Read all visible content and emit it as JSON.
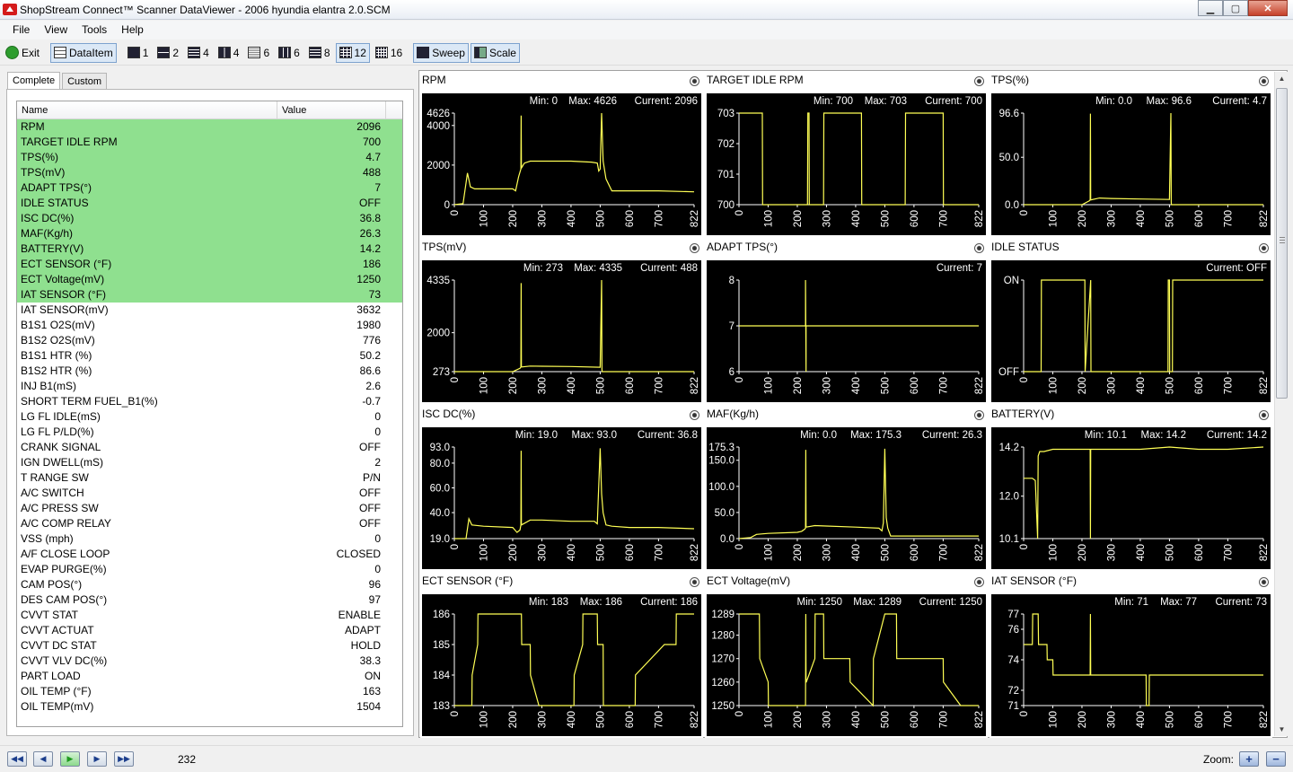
{
  "window": {
    "title": "ShopStream Connect™ Scanner DataViewer - 2006 hyundia elantra 2.0.SCM"
  },
  "menu": [
    "File",
    "View",
    "Tools",
    "Help"
  ],
  "toolbar": {
    "exit": "Exit",
    "dataitem": "DataItem",
    "layouts": [
      "1",
      "2",
      "4",
      "4",
      "6",
      "6",
      "8",
      "12",
      "16"
    ],
    "sweep": "Sweep",
    "scale": "Scale"
  },
  "tabs": [
    "Complete",
    "Custom"
  ],
  "grid": {
    "headers": [
      "Name",
      "Value"
    ],
    "rows": [
      [
        "RPM",
        "2096"
      ],
      [
        "TARGET IDLE RPM",
        "700"
      ],
      [
        "TPS(%)",
        "4.7"
      ],
      [
        "TPS(mV)",
        "488"
      ],
      [
        "ADAPT TPS(°)",
        "7"
      ],
      [
        "IDLE STATUS",
        "OFF"
      ],
      [
        "ISC DC(%)",
        "36.8"
      ],
      [
        "MAF(Kg/h)",
        "26.3"
      ],
      [
        "BATTERY(V)",
        "14.2"
      ],
      [
        "ECT SENSOR (°F)",
        "186"
      ],
      [
        "ECT Voltage(mV)",
        "1250"
      ],
      [
        "IAT SENSOR (°F)",
        "73"
      ],
      [
        "IAT SENSOR(mV)",
        "3632"
      ],
      [
        "B1S1 O2S(mV)",
        "1980"
      ],
      [
        "B1S2 O2S(mV)",
        "776"
      ],
      [
        "B1S1 HTR (%)",
        "50.2"
      ],
      [
        "B1S2 HTR (%)",
        "86.6"
      ],
      [
        "INJ B1(mS)",
        "2.6"
      ],
      [
        "SHORT TERM FUEL_B1(%)",
        "-0.7"
      ],
      [
        "LG FL IDLE(mS)",
        "0"
      ],
      [
        "LG FL P/LD(%)",
        "0"
      ],
      [
        "CRANK SIGNAL",
        "OFF"
      ],
      [
        "IGN DWELL(mS)",
        "2"
      ],
      [
        "T RANGE SW",
        "P/N"
      ],
      [
        "A/C SWITCH",
        "OFF"
      ],
      [
        "A/C PRESS SW",
        "OFF"
      ],
      [
        "A/C COMP RELAY",
        "OFF"
      ],
      [
        "VSS (mph)",
        "0"
      ],
      [
        "A/F CLOSE LOOP",
        "CLOSED"
      ],
      [
        "EVAP PURGE(%)",
        "0"
      ],
      [
        "CAM POS(°)",
        "96"
      ],
      [
        "DES CAM POS(°)",
        "97"
      ],
      [
        "CVVT STAT",
        "ENABLE"
      ],
      [
        "CVVT ACTUAT",
        "ADAPT"
      ],
      [
        "CVVT DC STAT",
        "HOLD"
      ],
      [
        "CVVT VLV DC(%)",
        "38.3"
      ],
      [
        "PART LOAD",
        "ON"
      ],
      [
        "OIL TEMP (°F)",
        "163"
      ],
      [
        "OIL TEMP(mV)",
        "1504"
      ]
    ],
    "highlight_count": 12,
    "highlight_color": "#8fe08f"
  },
  "xticks": [
    "0",
    "100",
    "200",
    "300",
    "400",
    "500",
    "600",
    "700",
    "822"
  ],
  "chart_data": [
    {
      "type": "line",
      "title": "RPM",
      "stats": {
        "min": "Min: 0",
        "max": "Max: 4626",
        "cur": "Current: 2096"
      },
      "yticks": [
        "4626",
        "4000",
        "2000",
        "0"
      ],
      "ylim": [
        0,
        4626
      ],
      "x": [
        0,
        30,
        45,
        55,
        70,
        80,
        200,
        210,
        220,
        228,
        229,
        230,
        240,
        260,
        300,
        400,
        470,
        490,
        495,
        500,
        505,
        510,
        520,
        540,
        600,
        700,
        822
      ],
      "y": [
        0,
        50,
        1600,
        900,
        800,
        800,
        800,
        700,
        1400,
        1800,
        4500,
        1850,
        2100,
        2200,
        2200,
        2200,
        2150,
        2100,
        1700,
        1800,
        4626,
        2200,
        1300,
        700,
        700,
        700,
        650
      ]
    },
    {
      "type": "line",
      "title": "TARGET IDLE RPM",
      "stats": {
        "min": "Min: 700",
        "max": "Max: 703",
        "cur": "Current: 700"
      },
      "yticks": [
        "703",
        "702",
        "701",
        "700"
      ],
      "ylim": [
        700,
        703
      ],
      "x": [
        0,
        80,
        81,
        235,
        236,
        240,
        241,
        290,
        291,
        420,
        421,
        570,
        571,
        700,
        701,
        822
      ],
      "y": [
        703,
        703,
        700,
        700,
        703,
        703,
        700,
        700,
        703,
        703,
        700,
        700,
        703,
        703,
        700,
        700
      ]
    },
    {
      "type": "line",
      "title": "TPS(%)",
      "stats": {
        "min": "Min: 0.0",
        "max": "Max: 96.6",
        "cur": "Current: 4.7"
      },
      "yticks": [
        "96.6",
        "50.0",
        "0.0"
      ],
      "ylim": [
        0,
        96.6
      ],
      "x": [
        0,
        200,
        225,
        228,
        229,
        230,
        260,
        300,
        400,
        500,
        505,
        506,
        507,
        560,
        822
      ],
      "y": [
        0,
        0,
        4,
        5,
        96,
        5,
        7,
        6.5,
        6,
        5.5,
        96.6,
        2,
        0,
        0,
        0
      ]
    },
    {
      "type": "line",
      "title": "TPS(mV)",
      "stats": {
        "min": "Min: 273",
        "max": "Max: 4335",
        "cur": "Current: 488"
      },
      "yticks": [
        "4335",
        "2000",
        "273"
      ],
      "ylim": [
        273,
        4335
      ],
      "x": [
        0,
        200,
        225,
        228,
        229,
        230,
        260,
        300,
        400,
        500,
        505,
        506,
        507,
        560,
        822
      ],
      "y": [
        273,
        273,
        420,
        480,
        4200,
        480,
        520,
        510,
        500,
        470,
        4335,
        350,
        273,
        273,
        273
      ]
    },
    {
      "type": "line",
      "title": "ADAPT TPS(°)",
      "stats": {
        "min": "",
        "max": "",
        "cur": "Current: 7"
      },
      "yticks": [
        "8",
        "7",
        "6"
      ],
      "ylim": [
        6,
        8
      ],
      "x": [
        0,
        228,
        228,
        230,
        230,
        822
      ],
      "y": [
        7,
        7,
        8,
        6,
        7,
        7
      ]
    },
    {
      "type": "line",
      "title": "IDLE STATUS",
      "stats": {
        "min": "",
        "max": "",
        "cur": "Current: OFF"
      },
      "yticks": [
        "ON",
        "OFF"
      ],
      "ylim": [
        0,
        1
      ],
      "x": [
        0,
        60,
        61,
        210,
        211,
        230,
        231,
        495,
        496,
        500,
        501,
        510,
        511,
        520,
        521,
        822
      ],
      "y": [
        0,
        0,
        1,
        1,
        0,
        1,
        0,
        0,
        1,
        1,
        0,
        0,
        1,
        1,
        1,
        1
      ]
    },
    {
      "type": "line",
      "title": "ISC DC(%)",
      "stats": {
        "min": "Min: 19.0",
        "max": "Max: 93.0",
        "cur": "Current: 36.8"
      },
      "yticks": [
        "93.0",
        "80.0",
        "60.0",
        "40.0",
        "19.0"
      ],
      "ylim": [
        19,
        93
      ],
      "x": [
        0,
        40,
        50,
        60,
        100,
        200,
        215,
        225,
        228,
        229,
        230,
        260,
        300,
        400,
        480,
        490,
        500,
        505,
        510,
        520,
        540,
        600,
        700,
        822
      ],
      "y": [
        19,
        19,
        35,
        30,
        29,
        28,
        24,
        26,
        30,
        90,
        30,
        34,
        34,
        33,
        33,
        31,
        92,
        55,
        40,
        30,
        29,
        28,
        28,
        27
      ]
    },
    {
      "type": "line",
      "title": "MAF(Kg/h)",
      "stats": {
        "min": "Min: 0.0",
        "max": "Max: 175.3",
        "cur": "Current: 26.3"
      },
      "yticks": [
        "175.3",
        "150.0",
        "100.0",
        "50.0",
        "0.0"
      ],
      "ylim": [
        0,
        175.3
      ],
      "x": [
        0,
        40,
        60,
        100,
        200,
        215,
        225,
        228,
        229,
        230,
        260,
        300,
        400,
        480,
        490,
        495,
        500,
        505,
        510,
        520,
        600,
        700,
        822
      ],
      "y": [
        0,
        2,
        8,
        10,
        12,
        14,
        18,
        20,
        170,
        22,
        25,
        24,
        22,
        20,
        15,
        30,
        172,
        40,
        20,
        5,
        5,
        5,
        5
      ]
    },
    {
      "type": "line",
      "title": "BATTERY(V)",
      "stats": {
        "min": "Min: 10.1",
        "max": "Max: 14.2",
        "cur": "Current: 14.2"
      },
      "yticks": [
        "14.2",
        "12.0",
        "10.1"
      ],
      "ylim": [
        10.1,
        14.2
      ],
      "x": [
        0,
        30,
        40,
        48,
        50,
        55,
        70,
        100,
        200,
        228,
        229,
        230,
        231,
        300,
        400,
        500,
        600,
        700,
        822
      ],
      "y": [
        12.8,
        12.8,
        12.7,
        10.1,
        13.8,
        14.0,
        14.0,
        14.1,
        14.1,
        14.1,
        10.1,
        14.1,
        14.1,
        14.1,
        14.1,
        14.2,
        14.1,
        14.1,
        14.2
      ]
    },
    {
      "type": "line",
      "title": "ECT SENSOR (°F)",
      "stats": {
        "min": "Min: 183",
        "max": "Max: 186",
        "cur": "Current: 186"
      },
      "yticks": [
        "186",
        "185",
        "184",
        "183"
      ],
      "ylim": [
        183,
        186
      ],
      "x": [
        0,
        60,
        61,
        80,
        81,
        230,
        231,
        260,
        261,
        290,
        291,
        410,
        411,
        440,
        441,
        490,
        491,
        510,
        511,
        520,
        521,
        620,
        621,
        720,
        721,
        760,
        761,
        822
      ],
      "y": [
        183,
        183,
        184,
        185,
        186,
        186,
        185,
        185,
        184,
        183,
        183,
        183,
        184,
        185,
        186,
        186,
        185,
        185,
        183,
        183,
        183,
        183,
        184,
        185,
        185,
        185,
        186,
        186
      ]
    },
    {
      "type": "line",
      "title": "ECT Voltage(mV)",
      "stats": {
        "min": "Min: 1250",
        "max": "Max: 1289",
        "cur": "Current: 1250"
      },
      "yticks": [
        "1289",
        "1280",
        "1270",
        "1260",
        "1250"
      ],
      "ylim": [
        1250,
        1289
      ],
      "x": [
        0,
        70,
        71,
        100,
        101,
        228,
        229,
        230,
        231,
        260,
        261,
        290,
        291,
        380,
        381,
        460,
        461,
        500,
        501,
        540,
        541,
        600,
        601,
        700,
        701,
        760,
        761,
        822
      ],
      "y": [
        1289,
        1289,
        1270,
        1260,
        1250,
        1250,
        1289,
        1260,
        1260,
        1270,
        1289,
        1289,
        1270,
        1270,
        1260,
        1250,
        1270,
        1289,
        1289,
        1289,
        1270,
        1270,
        1270,
        1270,
        1260,
        1250,
        1250,
        1250
      ]
    },
    {
      "type": "line",
      "title": "IAT SENSOR (°F)",
      "stats": {
        "min": "Min: 71",
        "max": "Max: 77",
        "cur": "Current: 73"
      },
      "yticks": [
        "77",
        "76",
        "74",
        "72",
        "71"
      ],
      "ylim": [
        71,
        77
      ],
      "x": [
        0,
        30,
        31,
        50,
        51,
        80,
        81,
        100,
        101,
        228,
        229,
        230,
        231,
        420,
        421,
        430,
        431,
        822
      ],
      "y": [
        75,
        75,
        77,
        77,
        75,
        75,
        74,
        74,
        73,
        73,
        77,
        73,
        73,
        73,
        71,
        71,
        73,
        73
      ]
    }
  ],
  "footer": {
    "position": "232",
    "zoom": "Zoom:",
    "nav_icons": [
      "first-icon",
      "prev-icon",
      "play-icon",
      "next-icon",
      "last-icon"
    ]
  }
}
